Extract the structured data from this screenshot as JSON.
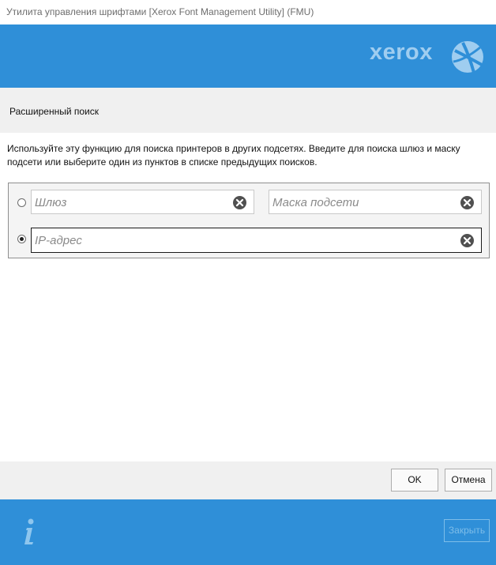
{
  "window": {
    "title": "Утилита управления шрифтами [Xerox Font Management Utility] (FMU)"
  },
  "header": {
    "logo_text": "xerox"
  },
  "section": {
    "title": "Расширенный поиск"
  },
  "description": {
    "line1": "Используйте эту функцию для поиска принтеров в других подсетях. Введите для поиска шлюз и маску",
    "line2": "подсети или выберите один из пунктов в списке предыдущих поисков."
  },
  "search": {
    "gateway": {
      "placeholder": "Шлюз",
      "value": ""
    },
    "subnet_mask": {
      "placeholder": "Маска подсети",
      "value": ""
    },
    "ip_address": {
      "placeholder": "IP-адрес",
      "value": ""
    },
    "selected_option": "ip_address"
  },
  "buttons": {
    "ok": "OK",
    "cancel": "Отмена",
    "close": "Закрыть"
  },
  "colors": {
    "brand_blue": "#2f8fd8",
    "logo_light": "#9fcdf0"
  }
}
